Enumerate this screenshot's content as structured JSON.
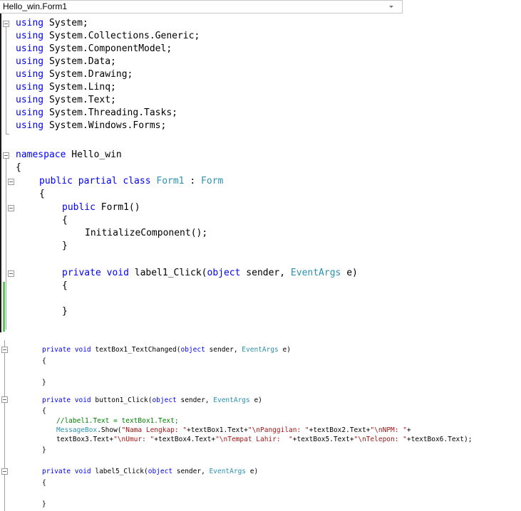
{
  "nav": {
    "class_dropdown": "Hello_win.Form1"
  },
  "editor_top": {
    "usings": [
      "System;",
      "System.Collections.Generic;",
      "System.ComponentModel;",
      "System.Data;",
      "System.Drawing;",
      "System.Linq;",
      "System.Text;",
      "System.Threading.Tasks;",
      "System.Windows.Forms;"
    ],
    "kw_using": "using",
    "kw_namespace": "namespace",
    "namespace_name": "Hello_win",
    "brace_open": "{",
    "brace_close": "}",
    "class_decl": {
      "kw": "public partial class",
      "name": "Form1",
      "sep": " : ",
      "base": "Form"
    },
    "ctor": {
      "kw": "public",
      "name": " Form1()"
    },
    "init_call": "InitializeComponent();",
    "label1_method": {
      "kw": "private void",
      "name": " label1_Click(",
      "kw_obj": "object",
      "sender": " sender, ",
      "type": "EventArgs",
      "tail": " e)"
    }
  },
  "editor_bottom": {
    "textbox_method": {
      "kw": "private void",
      "name": " textBox1_TextChanged(",
      "kw_obj": "object",
      "sender": " sender, ",
      "type": "EventArgs",
      "tail": " e)"
    },
    "button_method": {
      "kw": "private void",
      "name": " button1_Click(",
      "kw_obj": "object",
      "sender": " sender, ",
      "type": "EventArgs",
      "tail": " e)"
    },
    "comment_line": "//label1.Text = textBox1.Text;",
    "msg_line1": {
      "type": "MessageBox",
      "p1": ".Show(",
      "s1": "\"Nama Lengkap: \"",
      "p2": "+textBox1.Text+",
      "s2": "\"\\nPanggilan: \"",
      "p3": "+textBox2.Text+",
      "s3": "\"\\nNPM: \"",
      "p4": "+"
    },
    "msg_line2": {
      "p1": "textBox3.Text+",
      "s1": "\"\\nUmur: \"",
      "p2": "+textBox4.Text+",
      "s2": "\"\\nTempat Lahir:  \"",
      "p3": "+textBox5.Text+",
      "s3": "\"\\nTelepon: \"",
      "p4": "+textBox6.Text);"
    },
    "label5_method": {
      "kw": "private void",
      "name": " label5_Click(",
      "kw_obj": "object",
      "sender": " sender, ",
      "type": "EventArgs",
      "tail": " e)"
    },
    "brace_open": "{",
    "brace_close": "}"
  }
}
